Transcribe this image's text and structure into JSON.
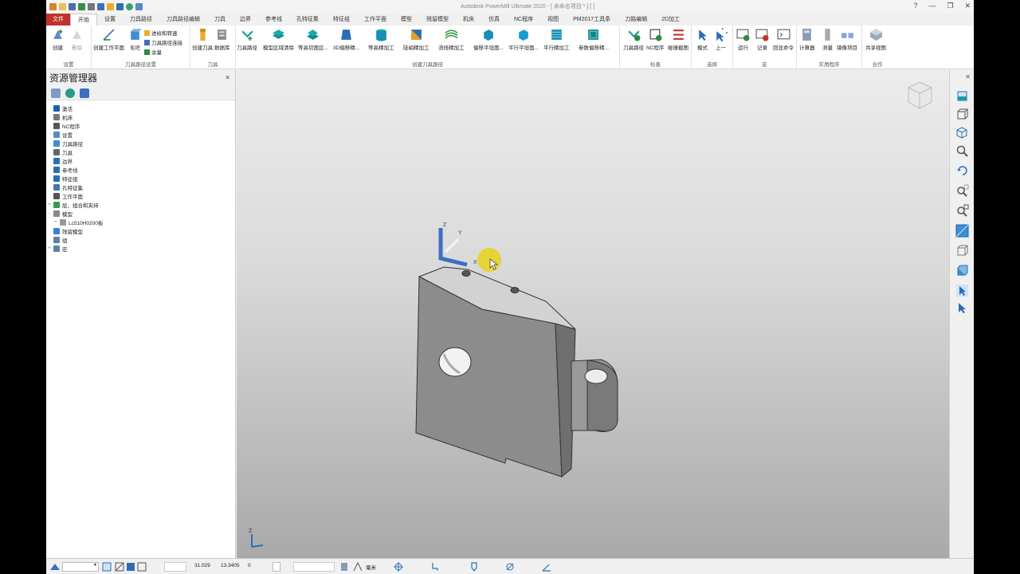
{
  "app": {
    "title": "Autodesk PowerMill Ultimate 2020 - [ 未命名项目 * ] [ ]"
  },
  "ribbon": {
    "tabs": [
      {
        "label": "文件"
      },
      {
        "label": "开始"
      },
      {
        "label": "设置"
      },
      {
        "label": "刀具路径"
      },
      {
        "label": "刀具路径编辑"
      },
      {
        "label": "刀具"
      },
      {
        "label": "边界"
      },
      {
        "label": "参考线"
      },
      {
        "label": "孔特征集"
      },
      {
        "label": "特征组"
      },
      {
        "label": "工作平面"
      },
      {
        "label": "模型"
      },
      {
        "label": "残留模型"
      },
      {
        "label": "机床"
      },
      {
        "label": "仿真"
      },
      {
        "label": "NC程序"
      },
      {
        "label": "视图"
      },
      {
        "label": "PM2017工具条"
      },
      {
        "label": "刀路编辑"
      },
      {
        "label": "2D加工"
      }
    ],
    "groups": {
      "setup": {
        "label": "设置",
        "create": "创建",
        "delete": "删除"
      },
      "toolpath_setup": {
        "label": "刀具路径设置",
        "create_workplane": "创建工作平面",
        "stock": "毛坯",
        "feeds": "进给和转速",
        "connections": "刀具路径连接",
        "thickness": "余量"
      },
      "tool": {
        "label": "刀具",
        "create_tool": "创建刀具",
        "database": "数据库"
      },
      "create_toolpath": {
        "label": "创建刀具路径",
        "items": [
          {
            "label": "刀具路径"
          },
          {
            "label": "模型区域清除"
          },
          {
            "label": "等高切面区..."
          },
          {
            "label": "3D偏移精..."
          },
          {
            "label": "等高精加工"
          },
          {
            "label": "陡峭精加工"
          },
          {
            "label": "流线精加工"
          },
          {
            "label": "偏移平坦面..."
          },
          {
            "label": "平行平坦面..."
          },
          {
            "label": "平行精加工"
          },
          {
            "label": "参数偏移精..."
          }
        ]
      },
      "check": {
        "label": "检查",
        "items": [
          {
            "label": "刀具路径"
          },
          {
            "label": "NC程序"
          },
          {
            "label": "碰撞截图"
          }
        ]
      },
      "select": {
        "label": "选择",
        "items": [
          {
            "label": "模式"
          },
          {
            "label": "上一"
          }
        ]
      },
      "macro": {
        "label": "宏",
        "items": [
          {
            "label": "运行"
          },
          {
            "label": "记录"
          },
          {
            "label": "回显命令"
          }
        ]
      },
      "utilities": {
        "label": "实用程序",
        "items": [
          {
            "label": "计算器"
          },
          {
            "label": "测量"
          },
          {
            "label": "镜像项目"
          }
        ]
      },
      "collab": {
        "label": "合作",
        "items": [
          {
            "label": "共享视图"
          }
        ]
      }
    }
  },
  "explorer": {
    "title": "资源管理器",
    "tree": [
      {
        "label": "激活",
        "color": "#1a5fb4",
        "expand": ""
      },
      {
        "label": "机床",
        "color": "#777777",
        "expand": ""
      },
      {
        "label": "NC程序",
        "color": "#555555",
        "expand": ""
      },
      {
        "label": "设置",
        "color": "#5b8ac4",
        "expand": ""
      },
      {
        "label": "刀具路径",
        "color": "#3d8fd1",
        "expand": ""
      },
      {
        "label": "刀具",
        "color": "#666666",
        "expand": ""
      },
      {
        "label": "边界",
        "color": "#2a6db5",
        "expand": ""
      },
      {
        "label": "参考线",
        "color": "#2a6db5",
        "expand": ""
      },
      {
        "label": "特征组",
        "color": "#2a6db5",
        "expand": ""
      },
      {
        "label": "孔特征集",
        "color": "#4477aa",
        "expand": ""
      },
      {
        "label": "工作平面",
        "color": "#555555",
        "expand": ""
      },
      {
        "label": "层、组合和夹持",
        "color": "#3a9a4a",
        "expand": "+"
      },
      {
        "label": "模型",
        "color": "#888888",
        "expand": "-"
      },
      {
        "label": "Lc510H0200板",
        "color": "#999999",
        "expand": "+",
        "indent": 1
      },
      {
        "label": "残留模型",
        "color": "#3b7dd8",
        "expand": ""
      },
      {
        "label": "组",
        "color": "#5e7fa8",
        "expand": ""
      },
      {
        "label": "宏",
        "color": "#5e7fa8",
        "expand": "+"
      }
    ]
  },
  "viewport": {
    "triad_labels": {
      "z": "Z",
      "y": "Y",
      "x": "X"
    },
    "corner_axis_label": "Z"
  },
  "status": {
    "coord_x": "31.029",
    "coord_y": "13.3405",
    "coord_z": "0",
    "units": "毫米"
  },
  "colors": {
    "file_tab": "#c0322b",
    "accent_blue": "#2a6db5",
    "teal": "#1a9a9a",
    "cursor_highlight": "#e8d21a"
  }
}
